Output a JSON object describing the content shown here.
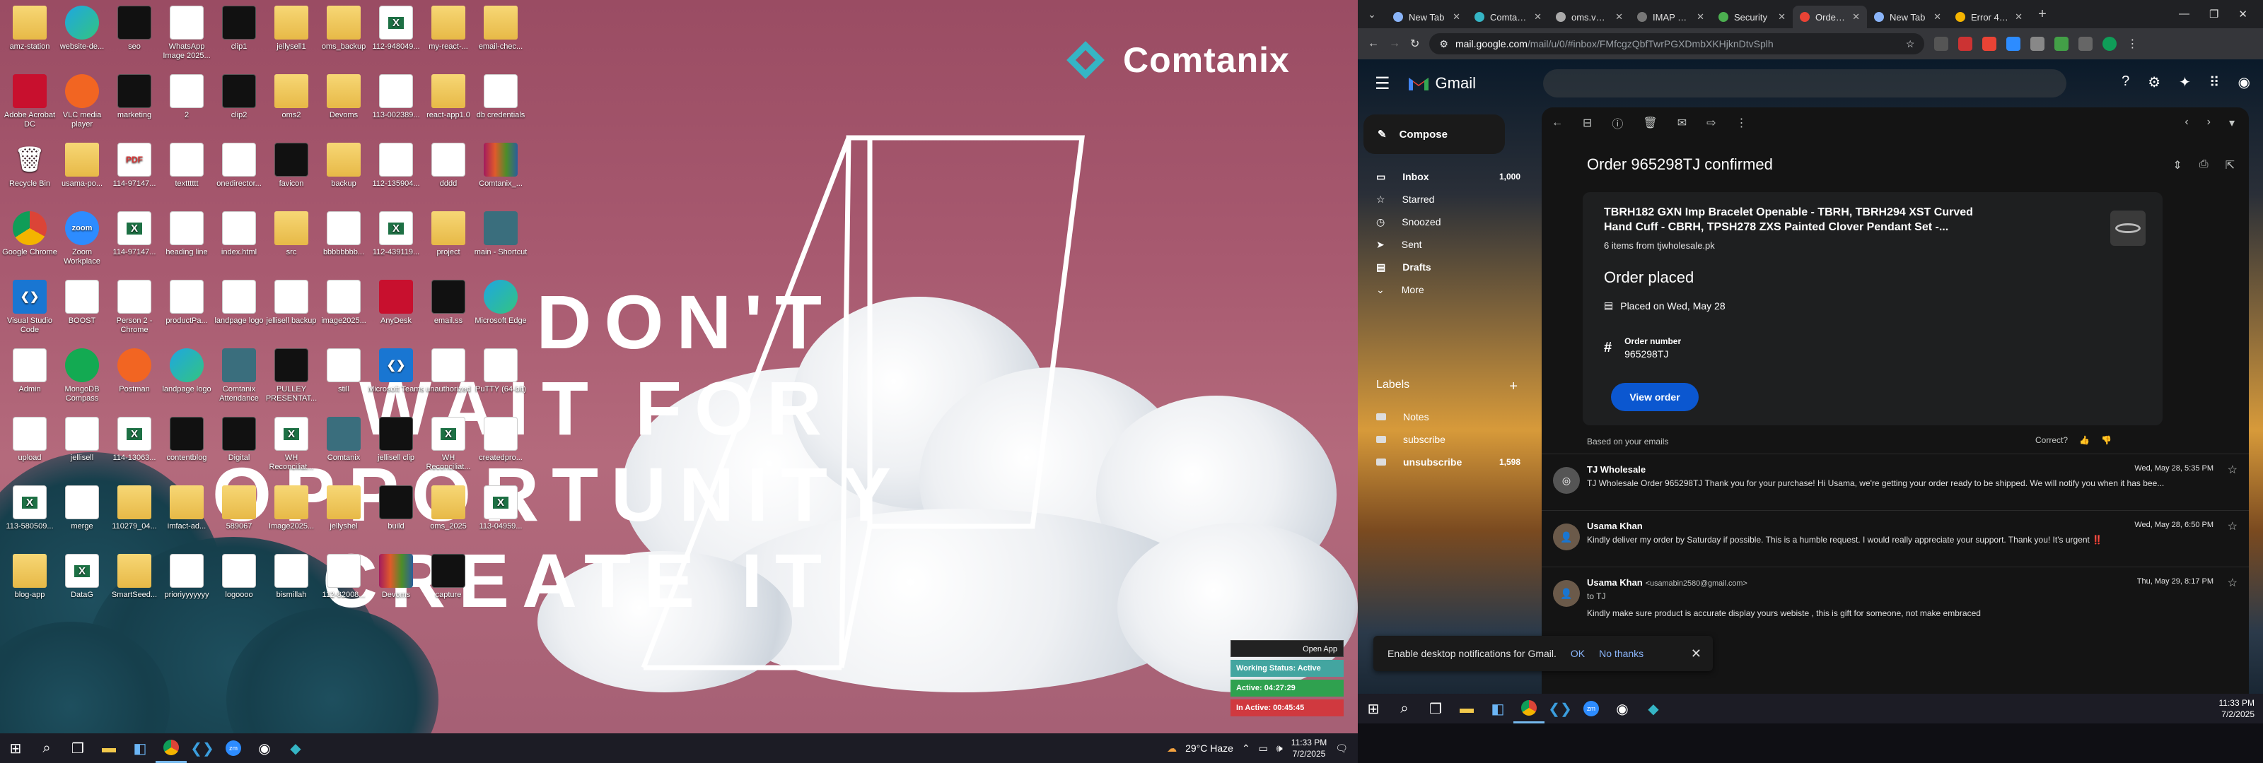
{
  "left_monitor": {
    "brand": "Comtanix",
    "quote_lines": [
      "DON'T",
      "WAIT FOR",
      "OPPORTUNITY",
      "CREATE IT"
    ],
    "desktop_icons": [
      {
        "label": "amz-station",
        "kind": "folder"
      },
      {
        "label": "website-de...",
        "kind": "edge"
      },
      {
        "label": "seo",
        "kind": "dark"
      },
      {
        "label": "WhatsApp Image 2025...",
        "kind": "doc"
      },
      {
        "label": "clip1",
        "kind": "dark"
      },
      {
        "label": "jellysell1",
        "kind": "folder"
      },
      {
        "label": "oms_backup",
        "kind": "folder"
      },
      {
        "label": "112-948049...",
        "kind": "excel"
      },
      {
        "label": "my-react-...",
        "kind": "folder"
      },
      {
        "label": "email-chec...",
        "kind": "folder"
      },
      {
        "label": "Adobe Acrobat DC",
        "kind": "red"
      },
      {
        "label": "VLC media player",
        "kind": "orange"
      },
      {
        "label": "marketing",
        "kind": "dark"
      },
      {
        "label": "2",
        "kind": "doc"
      },
      {
        "label": "clip2",
        "kind": "dark"
      },
      {
        "label": "oms2",
        "kind": "folder"
      },
      {
        "label": "Devoms",
        "kind": "folder"
      },
      {
        "label": "113-002389...",
        "kind": "doc"
      },
      {
        "label": "react-app1.0",
        "kind": "folder"
      },
      {
        "label": "db credentials",
        "kind": "doc"
      },
      {
        "label": "Recycle Bin",
        "kind": "recycle"
      },
      {
        "label": "usama-po...",
        "kind": "folder"
      },
      {
        "label": "114-97147...",
        "kind": "pdf"
      },
      {
        "label": "textttttt",
        "kind": "doc"
      },
      {
        "label": "onedirector...",
        "kind": "doc"
      },
      {
        "label": "favicon",
        "kind": "dark"
      },
      {
        "label": "backup",
        "kind": "folder"
      },
      {
        "label": "112-135904...",
        "kind": "doc"
      },
      {
        "label": "dddd",
        "kind": "doc"
      },
      {
        "label": "Comtanix_...",
        "kind": "rar"
      },
      {
        "label": "Google Chrome",
        "kind": "chrome"
      },
      {
        "label": "Zoom Workplace",
        "kind": "zoom"
      },
      {
        "label": "114-97147...",
        "kind": "excel"
      },
      {
        "label": "heading line",
        "kind": "doc"
      },
      {
        "label": "index.html",
        "kind": "doc"
      },
      {
        "label": "src",
        "kind": "folder"
      },
      {
        "label": "bbbbbbbb...",
        "kind": "doc"
      },
      {
        "label": "112-439119...",
        "kind": "excel"
      },
      {
        "label": "project",
        "kind": "folder"
      },
      {
        "label": "main - Shortcut",
        "kind": "teal"
      },
      {
        "label": "Visual Studio Code",
        "kind": "vscode"
      },
      {
        "label": "BOOST",
        "kind": "doc"
      },
      {
        "label": "Person 2 - Chrome",
        "kind": "doc"
      },
      {
        "label": "productPa...",
        "kind": "doc"
      },
      {
        "label": "landpage logo",
        "kind": "doc"
      },
      {
        "label": "jellisell backup",
        "kind": "doc"
      },
      {
        "label": "image2025...",
        "kind": "doc"
      },
      {
        "label": "AnyDesk",
        "kind": "red"
      },
      {
        "label": "email.ss",
        "kind": "dark"
      },
      {
        "label": "Microsoft Edge",
        "kind": "edge"
      },
      {
        "label": "Admin",
        "kind": "doc"
      },
      {
        "label": "MongoDB Compass",
        "kind": "green"
      },
      {
        "label": "Postman",
        "kind": "orange"
      },
      {
        "label": "landpage logo",
        "kind": "edge"
      },
      {
        "label": "Comtanix Attendance",
        "kind": "teal"
      },
      {
        "label": "PULLEY PRESENTAT...",
        "kind": "dark"
      },
      {
        "label": "still",
        "kind": "doc"
      },
      {
        "label": "Microsoft Teams",
        "kind": "vscode"
      },
      {
        "label": "unauthorized",
        "kind": "doc"
      },
      {
        "label": "PuTTY (64-bit)",
        "kind": "doc"
      },
      {
        "label": "upload",
        "kind": "doc"
      },
      {
        "label": "jellisell",
        "kind": "doc"
      },
      {
        "label": "114-13063...",
        "kind": "excel"
      },
      {
        "label": "contentblog",
        "kind": "dark"
      },
      {
        "label": "Digital",
        "kind": "dark"
      },
      {
        "label": "WH Reconciliat...",
        "kind": "excel"
      },
      {
        "label": "Comtanix",
        "kind": "teal"
      },
      {
        "label": "jellisell clip",
        "kind": "dark"
      },
      {
        "label": "WH Reconciliat...",
        "kind": "excel"
      },
      {
        "label": "createdpro...",
        "kind": "doc"
      },
      {
        "label": "113-580509...",
        "kind": "excel"
      },
      {
        "label": "merge",
        "kind": "doc"
      },
      {
        "label": "110279_04...",
        "kind": "folder"
      },
      {
        "label": "imfact-ad...",
        "kind": "folder"
      },
      {
        "label": "589067",
        "kind": "folder"
      },
      {
        "label": "Image2025...",
        "kind": "folder"
      },
      {
        "label": "jellyshel",
        "kind": "folder"
      },
      {
        "label": "build",
        "kind": "dark"
      },
      {
        "label": "oms_2025",
        "kind": "folder"
      },
      {
        "label": "113-04959...",
        "kind": "excel"
      },
      {
        "label": "blog-app",
        "kind": "folder"
      },
      {
        "label": "DataG",
        "kind": "excel"
      },
      {
        "label": "SmartSeed...",
        "kind": "folder"
      },
      {
        "label": "prioriyyyyyyy",
        "kind": "doc"
      },
      {
        "label": "logoooo",
        "kind": "doc"
      },
      {
        "label": "bismillah",
        "kind": "doc"
      },
      {
        "label": "112-82008...",
        "kind": "doc"
      },
      {
        "label": "Devoms",
        "kind": "rar"
      },
      {
        "label": "capture",
        "kind": "dark"
      }
    ],
    "widget": {
      "header": "Open App",
      "status": "Working Status: Active",
      "active": "Active: 04:27:29",
      "inactive": "In Active: 00:45:45",
      "status_color": "#43a5a0",
      "active_color": "#2fa14f",
      "inactive_color": "#d0393f"
    },
    "taskbar": {
      "weather": "29°C  Haze",
      "time": "11:33 PM",
      "date": "7/2/2025"
    }
  },
  "browser": {
    "tabs": [
      {
        "title": "New Tab",
        "active": false,
        "color": "#8ab4f8"
      },
      {
        "title": "Comtanix",
        "active": false,
        "color": "#35b5c5"
      },
      {
        "title": "oms.vclou...",
        "active": false,
        "color": "#aaaaaa"
      },
      {
        "title": "IMAP Erro...",
        "active": false,
        "color": "#777777"
      },
      {
        "title": "Security",
        "active": false,
        "color": "#4caf50"
      },
      {
        "title": "Order 96...",
        "active": true,
        "color": "#ea4335"
      },
      {
        "title": "New Tab",
        "active": false,
        "color": "#8ab4f8"
      },
      {
        "title": "Error 404 ...",
        "active": false,
        "color": "#f4b400"
      }
    ],
    "url_host": "mail.google.com",
    "url_path": "/mail/u/0/#inbox/FMfcgzQbfTwrPGXDmbXKHjknDtvSplh"
  },
  "gmail": {
    "product": "Gmail",
    "compose": "Compose",
    "nav": [
      {
        "label": "Inbox",
        "count": "1,000",
        "selected": true
      },
      {
        "label": "Starred",
        "count": ""
      },
      {
        "label": "Snoozed",
        "count": ""
      },
      {
        "label": "Sent",
        "count": ""
      },
      {
        "label": "Drafts",
        "count": "",
        "bold": true
      },
      {
        "label": "More",
        "count": ""
      }
    ],
    "labels_heading": "Labels",
    "labels": [
      {
        "label": "Notes",
        "count": ""
      },
      {
        "label": "subscribe",
        "count": ""
      },
      {
        "label": "unsubscribe",
        "count": "1,598",
        "bold": true
      }
    ],
    "subject": "Order 965298TJ confirmed",
    "card": {
      "title": "TBRH182 GXN Imp Bracelet Openable - TBRH, TBRH294 XST Curved Hand Cuff - CBRH, TPSH278 ZXS Painted Clover Pendant Set -...",
      "items": "6 items from tjwholesale.pk",
      "status": "Order placed",
      "placed": "Placed on Wed, May 28",
      "order_number_label": "Order number",
      "order_number": "965298TJ",
      "button": "View order"
    },
    "based_on": "Based on your emails",
    "correct": "Correct?",
    "messages": [
      {
        "from": "TJ Wholesale",
        "email": "",
        "date": "Wed, May 28, 5:35 PM",
        "snippet": "TJ Wholesale Order 965298TJ Thank you for your purchase! Hi Usama, we're getting your order ready to be shipped. We will notify you when it has bee..."
      },
      {
        "from": "Usama Khan",
        "email": "",
        "date": "Wed, May 28, 6:50 PM",
        "snippet": "Kindly deliver my order by Saturday if possible. This is a humble request. I would really appreciate your support. Thank you! It's urgent ‼️"
      },
      {
        "from": "Usama Khan",
        "email": "<usamabin2580@gmail.com>",
        "date": "Thu, May 29, 8:17 PM",
        "to": "to TJ",
        "snippet": "Kindly make sure product is accurate display yours webiste , this is gift for someone, not make embraced"
      }
    ],
    "notification": {
      "text": "Enable desktop notifications for Gmail.",
      "ok": "OK",
      "no": "No thanks"
    }
  },
  "right_taskbar": {
    "time": "11:33 PM",
    "date": "7/2/2025"
  }
}
